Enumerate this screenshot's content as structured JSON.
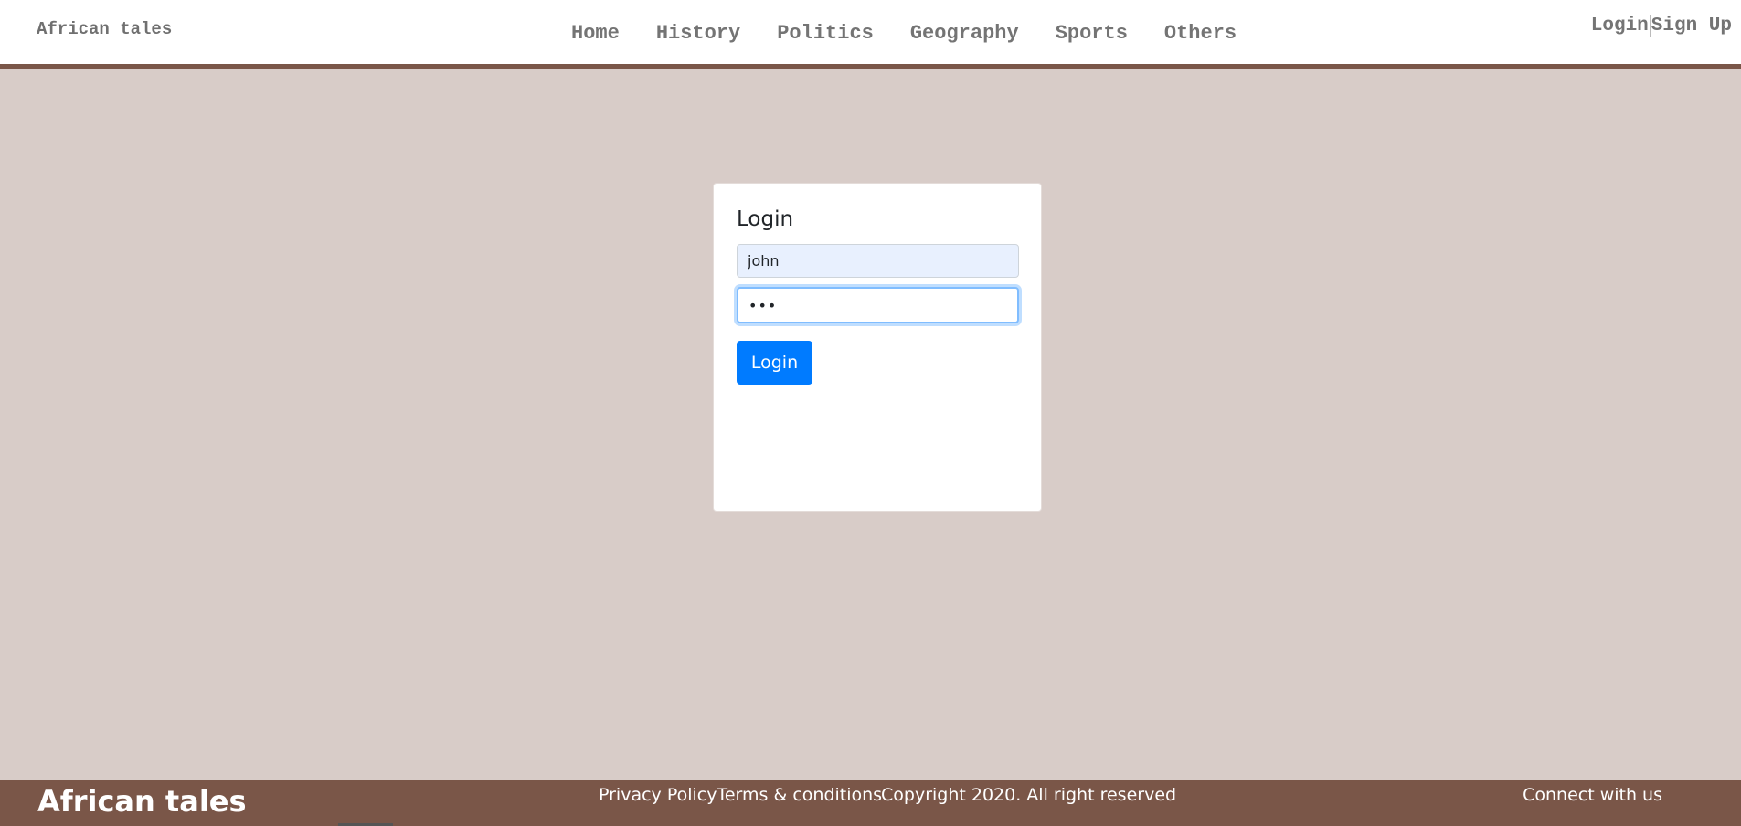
{
  "header": {
    "brand": "African tales",
    "nav": [
      "Home",
      "History",
      "Politics",
      "Geography",
      "Sports",
      "Others"
    ],
    "login_label": "Login",
    "signup_label": "Sign Up"
  },
  "login_form": {
    "title": "Login",
    "username_value": "john",
    "password_value": "•••",
    "submit_label": "Login"
  },
  "footer": {
    "brand": "African tales",
    "privacy_label": "Privacy Policy",
    "terms_label": "Terms & conditions",
    "copyright": "Copyright 2020. All right reserved",
    "connect": "Connect with us"
  },
  "colors": {
    "page_background": "#d8ccc8",
    "accent_brown": "#7a5648",
    "primary_button": "#007bff"
  }
}
